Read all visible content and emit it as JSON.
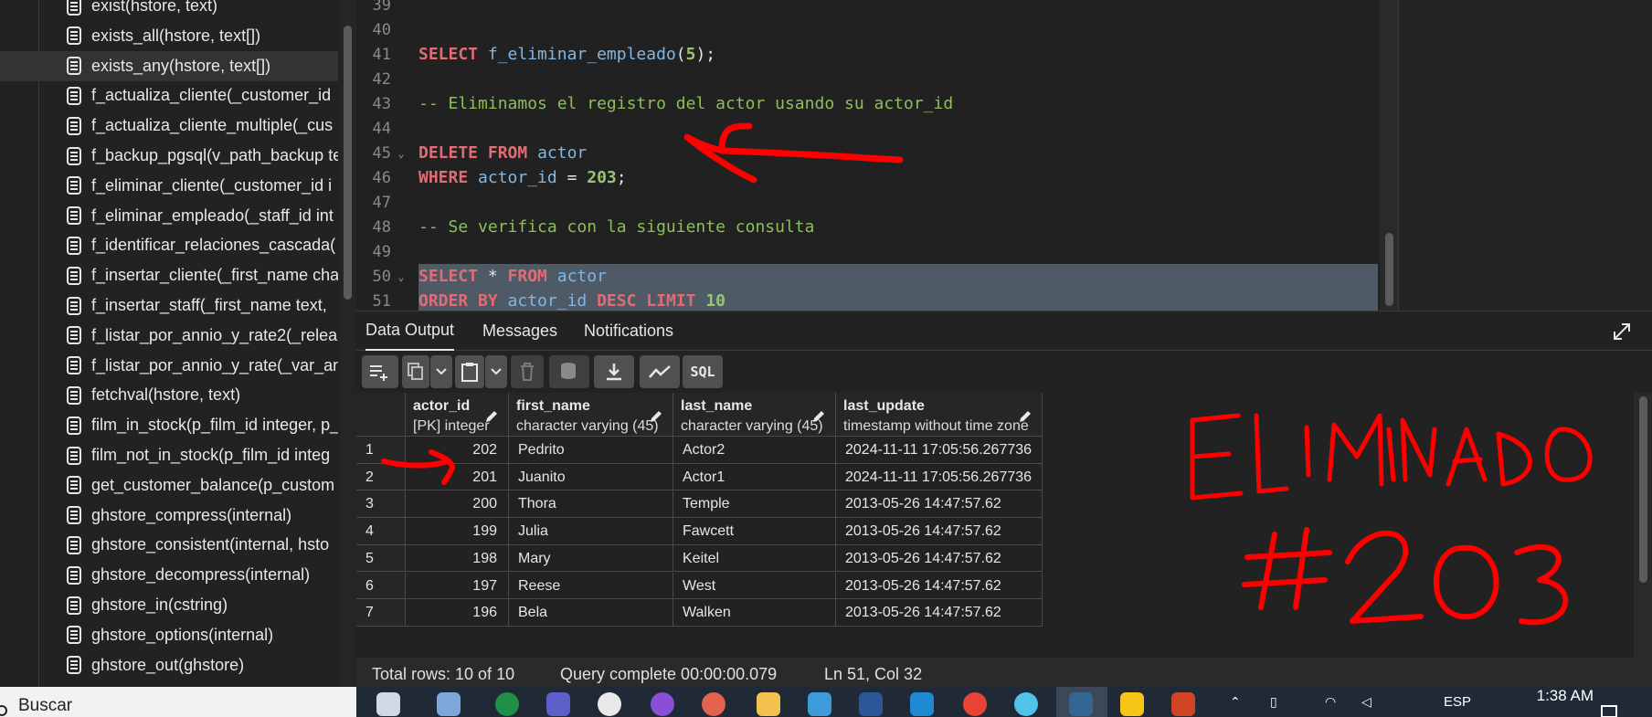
{
  "tree": {
    "items": [
      {
        "label": "exist(hstore, text)",
        "selected": false
      },
      {
        "label": "exists_all(hstore, text[])",
        "selected": false
      },
      {
        "label": "exists_any(hstore, text[])",
        "selected": true
      },
      {
        "label": "f_actualiza_cliente(_customer_id",
        "selected": false
      },
      {
        "label": "f_actualiza_cliente_multiple(_cus",
        "selected": false
      },
      {
        "label": "f_backup_pgsql(v_path_backup te",
        "selected": false
      },
      {
        "label": "f_eliminar_cliente(_customer_id i",
        "selected": false
      },
      {
        "label": "f_eliminar_empleado(_staff_id int",
        "selected": false
      },
      {
        "label": "f_identificar_relaciones_cascada(",
        "selected": false
      },
      {
        "label": "f_insertar_cliente(_first_name cha",
        "selected": false
      },
      {
        "label": "f_insertar_staff(_first_name text,",
        "selected": false
      },
      {
        "label": "f_listar_por_annio_y_rate2(_releas",
        "selected": false
      },
      {
        "label": "f_listar_por_annio_y_rate(_var_an",
        "selected": false
      },
      {
        "label": "fetchval(hstore, text)",
        "selected": false
      },
      {
        "label": "film_in_stock(p_film_id integer, p_",
        "selected": false
      },
      {
        "label": "film_not_in_stock(p_film_id integ",
        "selected": false
      },
      {
        "label": "get_customer_balance(p_custom",
        "selected": false
      },
      {
        "label": "ghstore_compress(internal)",
        "selected": false
      },
      {
        "label": "ghstore_consistent(internal, hsto",
        "selected": false
      },
      {
        "label": "ghstore_decompress(internal)",
        "selected": false
      },
      {
        "label": "ghstore_in(cstring)",
        "selected": false
      },
      {
        "label": "ghstore_options(internal)",
        "selected": false
      },
      {
        "label": "ghstore_out(ghstore)",
        "selected": false
      }
    ]
  },
  "editor": {
    "lines": [
      {
        "n": "39",
        "fold": false,
        "hl": false,
        "tokens": []
      },
      {
        "n": "40",
        "fold": false,
        "hl": false,
        "tokens": []
      },
      {
        "n": "41",
        "fold": false,
        "hl": false,
        "tokens": [
          [
            "kw",
            "SELECT"
          ],
          [
            "txt",
            " "
          ],
          [
            "id",
            "f_eliminar_empleado"
          ],
          [
            "txt",
            "("
          ],
          [
            "num",
            "5"
          ],
          [
            "txt",
            ");"
          ]
        ]
      },
      {
        "n": "42",
        "fold": false,
        "hl": false,
        "tokens": []
      },
      {
        "n": "43",
        "fold": false,
        "hl": false,
        "tokens": [
          [
            "cm",
            "-- Eliminamos el registro del actor usando su actor_id"
          ]
        ]
      },
      {
        "n": "44",
        "fold": false,
        "hl": false,
        "tokens": []
      },
      {
        "n": "45",
        "fold": true,
        "hl": false,
        "tokens": [
          [
            "kw",
            "DELETE FROM"
          ],
          [
            "txt",
            " "
          ],
          [
            "id",
            "actor"
          ]
        ]
      },
      {
        "n": "46",
        "fold": false,
        "hl": false,
        "tokens": [
          [
            "kw",
            "WHERE"
          ],
          [
            "txt",
            " "
          ],
          [
            "id",
            "actor_id"
          ],
          [
            "txt",
            " = "
          ],
          [
            "num",
            "203"
          ],
          [
            "txt",
            ";"
          ]
        ]
      },
      {
        "n": "47",
        "fold": false,
        "hl": false,
        "tokens": []
      },
      {
        "n": "48",
        "fold": false,
        "hl": false,
        "tokens": [
          [
            "cm",
            "-- Se verifica con la siguiente consulta"
          ]
        ]
      },
      {
        "n": "49",
        "fold": false,
        "hl": false,
        "tokens": []
      },
      {
        "n": "50",
        "fold": true,
        "hl": true,
        "tokens": [
          [
            "kw",
            "SELECT"
          ],
          [
            "txt",
            " * "
          ],
          [
            "kw",
            "FROM"
          ],
          [
            "txt",
            " "
          ],
          [
            "id",
            "actor"
          ]
        ]
      },
      {
        "n": "51",
        "fold": false,
        "hl": true,
        "tokens": [
          [
            "kw",
            "ORDER BY"
          ],
          [
            "txt",
            " "
          ],
          [
            "id",
            "actor_id"
          ],
          [
            "txt",
            " "
          ],
          [
            "kw",
            "DESC LIMIT"
          ],
          [
            "txt",
            " "
          ],
          [
            "num",
            "10"
          ]
        ]
      }
    ]
  },
  "tabs": {
    "data_output": "Data Output",
    "messages": "Messages",
    "notifications": "Notifications"
  },
  "toolbar": {
    "sql_label": "SQL"
  },
  "grid": {
    "columns": [
      {
        "name": "actor_id",
        "type": "[PK] integer"
      },
      {
        "name": "first_name",
        "type": "character varying (45)"
      },
      {
        "name": "last_name",
        "type": "character varying (45)"
      },
      {
        "name": "last_update",
        "type": "timestamp without time zone"
      }
    ],
    "rows": [
      {
        "n": "1",
        "actor_id": "202",
        "first_name": "Pedrito",
        "last_name": "Actor2",
        "last_update": "2024-11-11 17:05:56.267736"
      },
      {
        "n": "2",
        "actor_id": "201",
        "first_name": "Juanito",
        "last_name": "Actor1",
        "last_update": "2024-11-11 17:05:56.267736"
      },
      {
        "n": "3",
        "actor_id": "200",
        "first_name": "Thora",
        "last_name": "Temple",
        "last_update": "2013-05-26 14:47:57.62"
      },
      {
        "n": "4",
        "actor_id": "199",
        "first_name": "Julia",
        "last_name": "Fawcett",
        "last_update": "2013-05-26 14:47:57.62"
      },
      {
        "n": "5",
        "actor_id": "198",
        "first_name": "Mary",
        "last_name": "Keitel",
        "last_update": "2013-05-26 14:47:57.62"
      },
      {
        "n": "6",
        "actor_id": "197",
        "first_name": "Reese",
        "last_name": "West",
        "last_update": "2013-05-26 14:47:57.62"
      },
      {
        "n": "7",
        "actor_id": "196",
        "first_name": "Bela",
        "last_name": "Walken",
        "last_update": "2013-05-26 14:47:57.62"
      }
    ]
  },
  "status": {
    "total_rows": "Total rows: 10 of 10",
    "query": "Query complete 00:00:00.079",
    "cursor": "Ln 51, Col 32"
  },
  "taskbar": {
    "search_label": "Buscar",
    "lang": "ESP",
    "time": "1:38 AM"
  },
  "annotations": {
    "line1": "ELIMINADO",
    "line2": "#203",
    "color": "#ff0000"
  },
  "colors": {
    "background": "#222222",
    "keyword": "#e06c75",
    "identifier": "#7fb8e6",
    "number": "#98c379",
    "comment": "#8cbf5a",
    "selection": "#4e5a66"
  }
}
